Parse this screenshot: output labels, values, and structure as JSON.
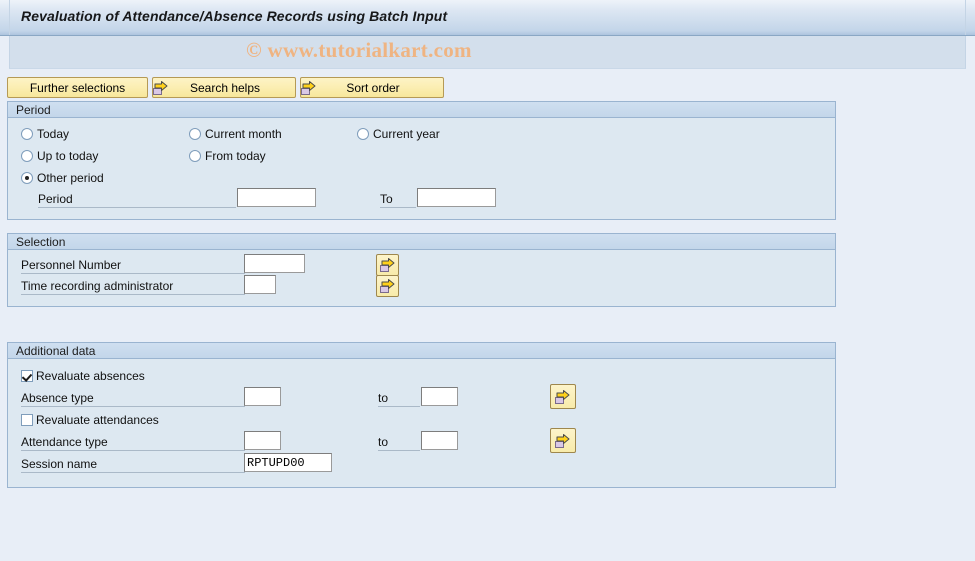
{
  "window": {
    "title": "Revaluation of Attendance/Absence Records using Batch Input",
    "watermark": "© www.tutorialkart.com"
  },
  "toolbar": {
    "buttons": [
      {
        "label": "Further selections",
        "icon": "",
        "has_icon": false
      },
      {
        "label": "Search helps",
        "icon": "arrow-right-icon",
        "has_icon": true
      },
      {
        "label": "Sort order",
        "icon": "arrow-right-icon",
        "has_icon": true
      }
    ]
  },
  "period": {
    "header": "Period",
    "radios": [
      {
        "label": "Today",
        "checked": false
      },
      {
        "label": "Current month",
        "checked": false
      },
      {
        "label": "Current year",
        "checked": false
      },
      {
        "label": "Up to today",
        "checked": false
      },
      {
        "label": "From today",
        "checked": false
      },
      {
        "label": "Other period",
        "checked": true
      }
    ],
    "period_label": "Period",
    "period_value": "",
    "to_label": "To",
    "to_value": ""
  },
  "selection": {
    "header": "Selection",
    "personnel_number_label": "Personnel Number",
    "personnel_number_value": "",
    "time_admin_label": "Time recording administrator",
    "time_admin_value": "",
    "multi_select_icon": "arrow-right-icon"
  },
  "additional": {
    "header": "Additional data",
    "revaluate_absences_label": "Revaluate absences",
    "revaluate_absences_checked": true,
    "absence_type_label": "Absence type",
    "absence_type_from": "",
    "absence_type_to": "",
    "revaluate_attendances_label": "Revaluate attendances",
    "revaluate_attendances_checked": false,
    "attendance_type_label": "Attendance type",
    "attendance_type_from": "",
    "attendance_type_to": "",
    "to_label": "to",
    "session_name_label": "Session name",
    "session_name_value": "RPTUPD00",
    "multi_select_icon": "arrow-right-icon"
  },
  "colors": {
    "page_background": "#e8eef7",
    "panel_background": "#dde8f1",
    "panel_header": "#c3d6ea",
    "panel_border": "#9ab4d0",
    "button_yellow": "#fbeeb2",
    "watermark": "#efb482",
    "title_text": "#17181a"
  }
}
